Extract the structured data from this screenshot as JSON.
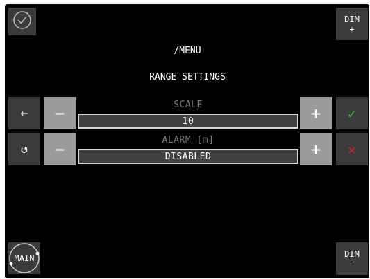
{
  "header": {
    "path": "/MENU",
    "title": "RANGE SETTINGS"
  },
  "buttons": {
    "confirm_top": {
      "icon": "check-circle-icon"
    },
    "dim_plus": {
      "line1": "DIM",
      "line2": "+"
    },
    "dim_minus": {
      "line1": "DIM",
      "line2": "-"
    },
    "main": {
      "label": "MAIN"
    },
    "back": {
      "icon": "arrow-left-icon",
      "glyph": "←"
    },
    "reset": {
      "icon": "reset-icon",
      "glyph": "↺"
    },
    "accept": {
      "icon": "check-icon",
      "glyph": "✓",
      "color": "#3dbb3d"
    },
    "cancel": {
      "icon": "close-icon",
      "glyph": "✕",
      "color": "#c0282f"
    }
  },
  "settings": [
    {
      "label": "SCALE",
      "value": "10",
      "minus": "−",
      "plus": "+"
    },
    {
      "label": "ALARM [m]",
      "value": "DISABLED",
      "minus": "−",
      "plus": "+"
    }
  ],
  "colors": {
    "background": "#000000",
    "button_dark": "#3b3b3b",
    "button_light": "#9b9b9b",
    "field_bg": "#404040"
  }
}
